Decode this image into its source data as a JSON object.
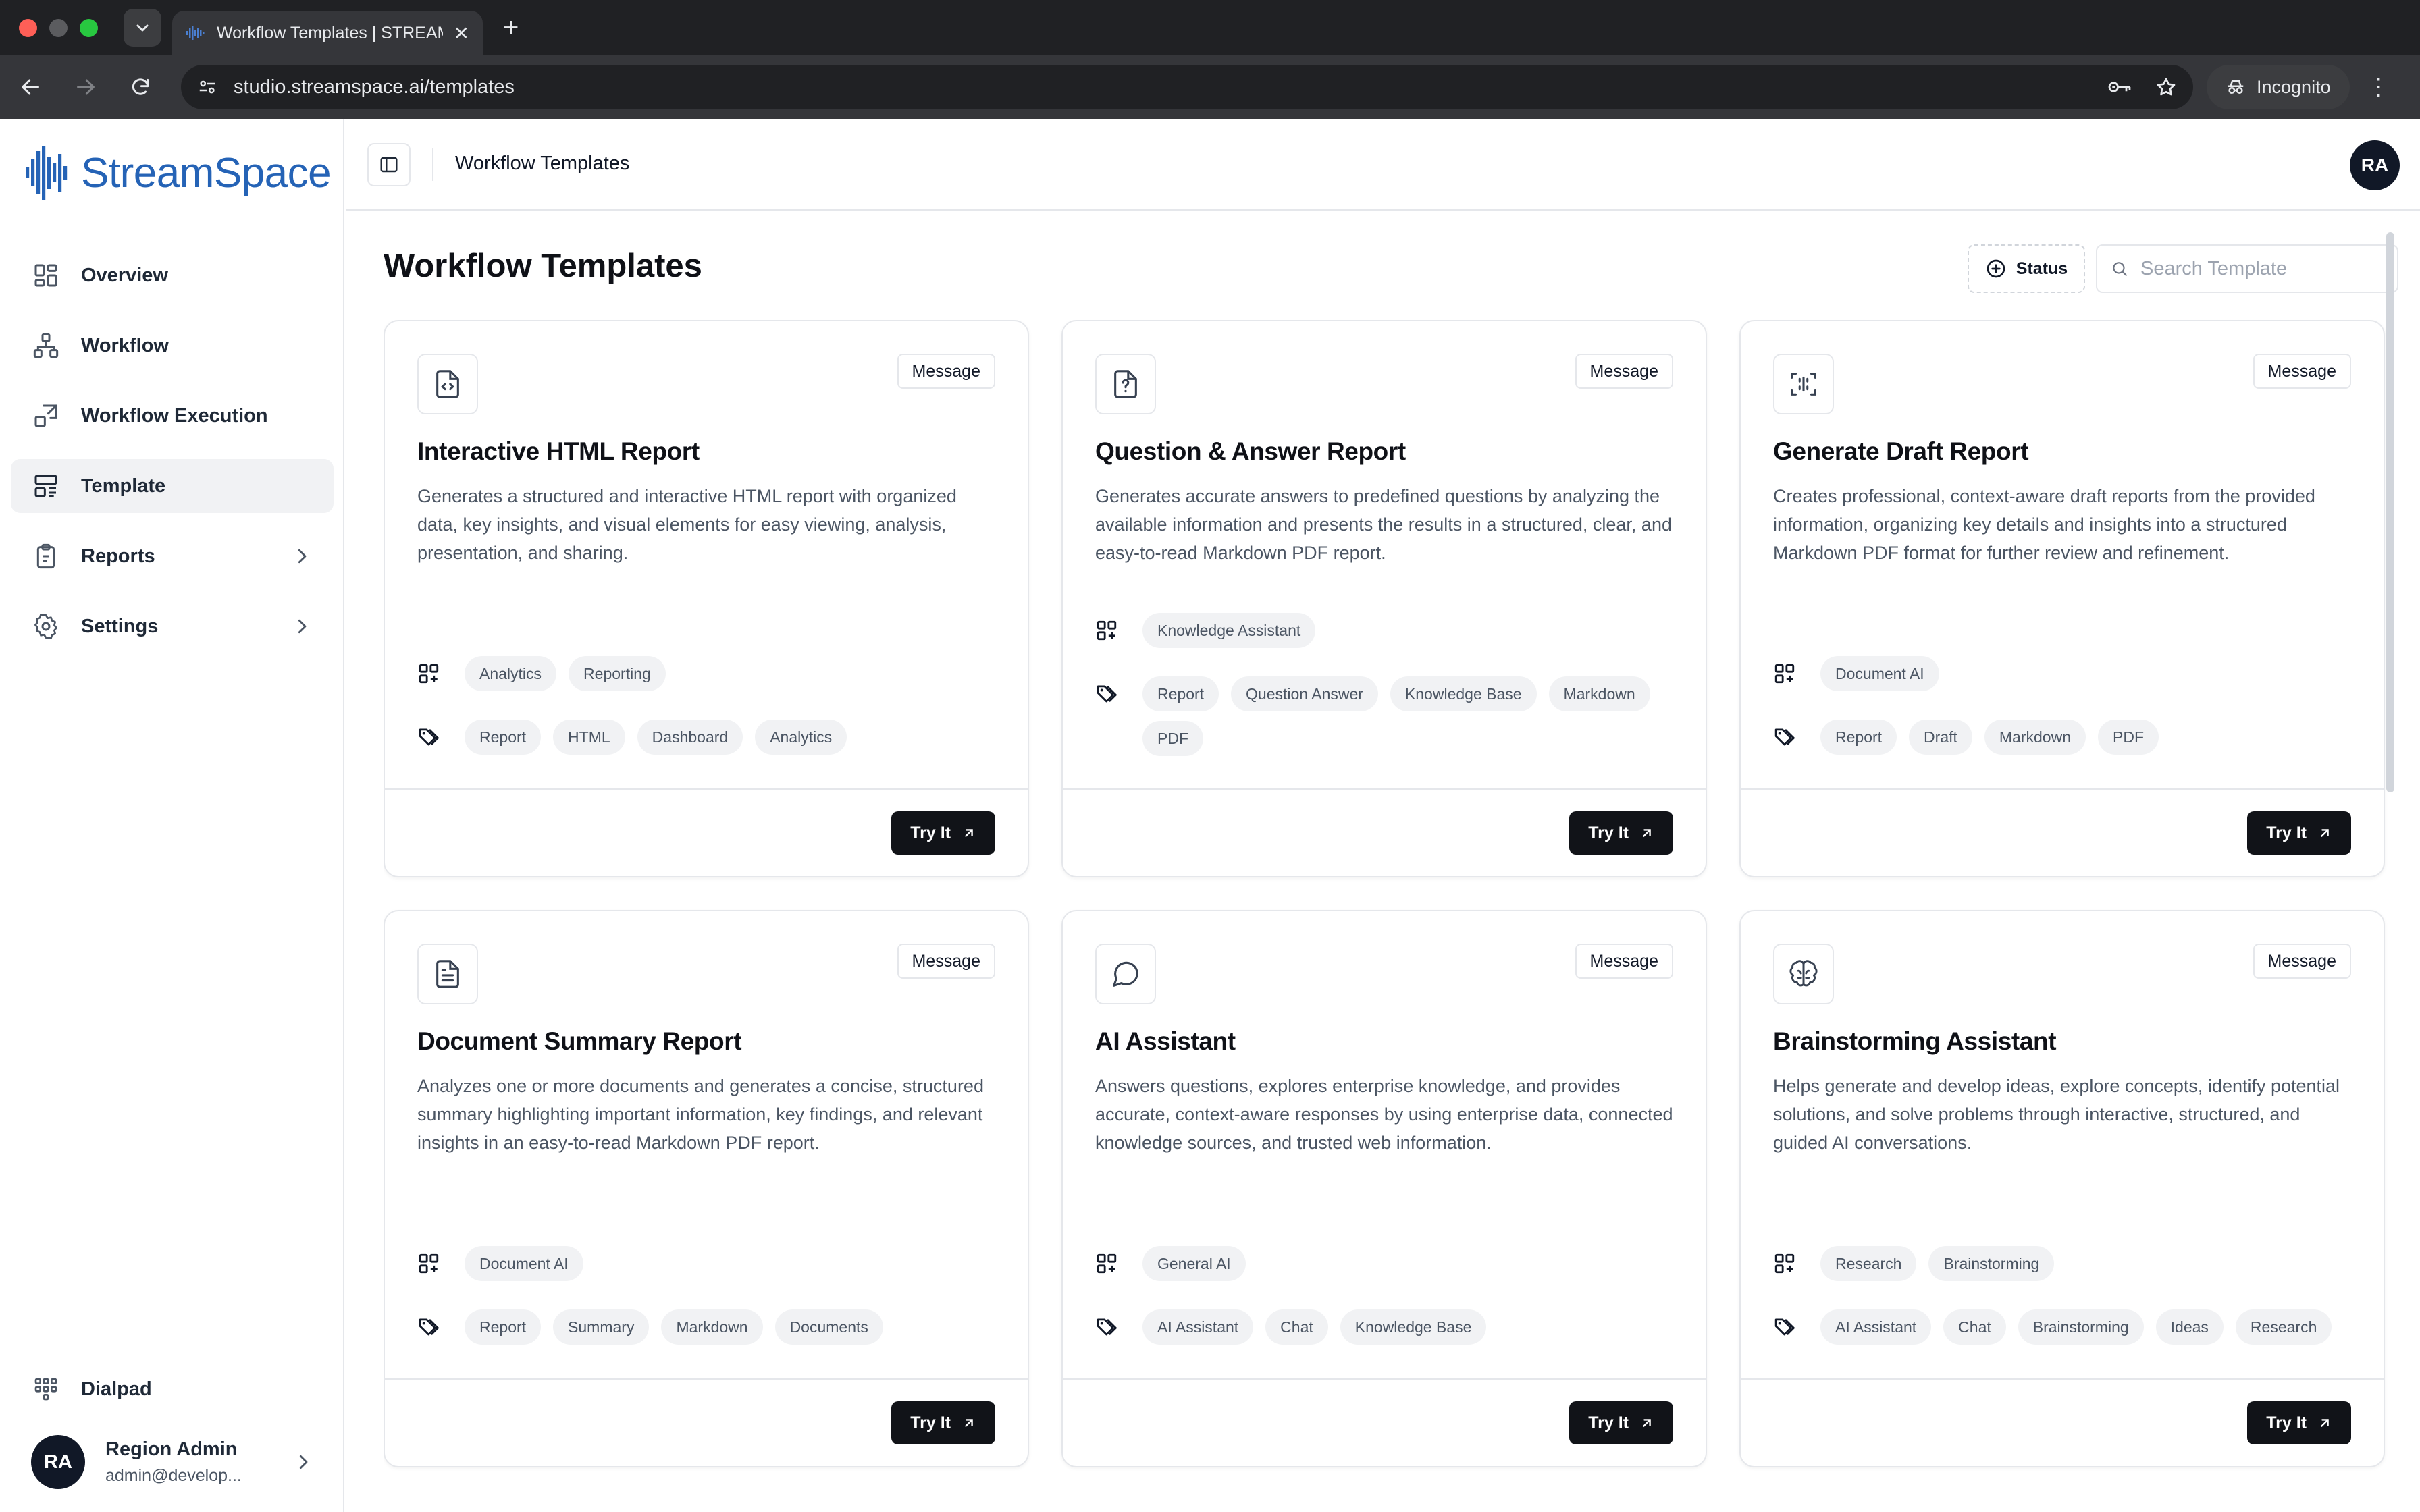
{
  "browser": {
    "tab_title": "Workflow Templates | STREAMSPACE",
    "url": "studio.streamspace.ai/templates",
    "profile_label": "Incognito"
  },
  "brand": {
    "name": "StreamSpace",
    "color": "#2563b6"
  },
  "sidebar": {
    "items": [
      {
        "label": "Overview",
        "icon": "grid-icon",
        "active": false
      },
      {
        "label": "Workflow",
        "icon": "workflow-icon",
        "active": false
      },
      {
        "label": "Workflow Execution",
        "icon": "execution-icon",
        "active": false
      },
      {
        "label": "Template",
        "icon": "template-icon",
        "active": true
      },
      {
        "label": "Reports",
        "icon": "clipboard-icon",
        "active": false,
        "has_children": true
      },
      {
        "label": "Settings",
        "icon": "gear-icon",
        "active": false,
        "has_children": true
      }
    ],
    "dialpad_label": "Dialpad",
    "user": {
      "initials": "RA",
      "name": "Region Admin",
      "email": "admin@develop..."
    }
  },
  "topbar": {
    "breadcrumb": "Workflow Templates",
    "avatar_initials": "RA"
  },
  "page": {
    "title": "Workflow Templates",
    "status_filter_label": "Status",
    "search_placeholder": "Search Template"
  },
  "cards": [
    {
      "icon": "file-code-icon",
      "badge": "Message",
      "title": "Interactive HTML Report",
      "description": "Generates a structured and interactive HTML report with organized data, key insights, and visual elements for easy viewing, analysis, presentation, and sharing.",
      "categories": [
        "Analytics",
        "Reporting"
      ],
      "tags": [
        "Report",
        "HTML",
        "Dashboard",
        "Analytics"
      ],
      "cta": "Try It"
    },
    {
      "icon": "file-question-icon",
      "badge": "Message",
      "title": "Question & Answer Report",
      "description": "Generates accurate answers to predefined questions by analyzing the available information and presents the results in a structured, clear, and easy-to-read Markdown PDF report.",
      "categories": [
        "Knowledge Assistant"
      ],
      "tags": [
        "Report",
        "Question Answer",
        "Knowledge Base",
        "Markdown",
        "PDF"
      ],
      "cta": "Try It"
    },
    {
      "icon": "scan-text-icon",
      "badge": "Message",
      "title": "Generate Draft Report",
      "description": "Creates professional, context-aware draft reports from the provided information, organizing key details and insights into a structured Markdown PDF format for further review and refinement.",
      "categories": [
        "Document AI"
      ],
      "tags": [
        "Report",
        "Draft",
        "Markdown",
        "PDF"
      ],
      "cta": "Try It"
    },
    {
      "icon": "file-text-icon",
      "badge": "Message",
      "title": "Document Summary Report",
      "description": "Analyzes one or more documents and generates a concise, structured summary highlighting important information, key findings, and relevant insights in an easy-to-read Markdown PDF report.",
      "categories": [
        "Document AI"
      ],
      "tags": [
        "Report",
        "Summary",
        "Markdown",
        "Documents"
      ],
      "cta": "Try It"
    },
    {
      "icon": "chat-bubble-icon",
      "badge": "Message",
      "title": "AI Assistant",
      "description": "Answers questions, explores enterprise knowledge, and provides accurate, context-aware responses by using enterprise data, connected knowledge sources, and trusted web information.",
      "categories": [
        "General AI"
      ],
      "tags": [
        "AI Assistant",
        "Chat",
        "Knowledge Base"
      ],
      "cta": "Try It"
    },
    {
      "icon": "brain-icon",
      "badge": "Message",
      "title": "Brainstorming Assistant",
      "description": "Helps generate and develop ideas, explore concepts, identify potential solutions, and solve problems through interactive, structured, and guided AI conversations.",
      "categories": [
        "Research",
        "Brainstorming"
      ],
      "tags": [
        "AI Assistant",
        "Chat",
        "Brainstorming",
        "Ideas",
        "Research"
      ],
      "cta": "Try It"
    }
  ]
}
